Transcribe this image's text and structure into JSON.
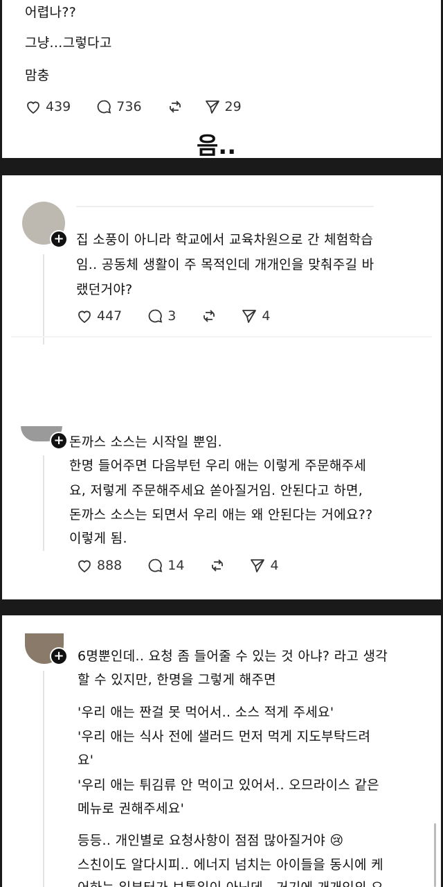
{
  "post1": {
    "lines": [
      "어렵나??",
      "그냥...그렇다고",
      "맘충"
    ],
    "likes": "439",
    "comments": "736",
    "shares": "29"
  },
  "caption": "음..",
  "post2": {
    "lines": [
      "집 소풍이 아니라 학교에서 교육차원으로 간 체험학습",
      "임.. 공동체 생활이 주 목적인데 개개인을 맞춰주길 바",
      "랬던거야?"
    ],
    "likes": "447",
    "comments": "3",
    "shares": "4"
  },
  "post3": {
    "lines": [
      "돈까스 소스는 시작일 뿐임.",
      "한명 들어주면 다음부턴 우리 애는 이렇게 주문해주세",
      "요, 저렇게 주문해주세요 쏟아질거임. 안된다고 하면,",
      "돈까스 소스는 되면서 우리 애는 왜 안된다는 거에요??",
      "이렇게 됨."
    ],
    "likes": "888",
    "comments": "14",
    "shares": "4"
  },
  "post4": {
    "lines": [
      "6명뿐인데.. 요청 좀 들어줄 수 있는 것 아냐? 라고 생각",
      "할 수 있지만, 한명을 그렇게 해주면",
      "'우리 애는 짠걸 못 먹어서.. 소스 적게 주세요'",
      "'우리 애는 식사 전에 샐러드 먼저 먹게 지도부탁드려",
      "요'",
      "'우리 애는 튀김류 안 먹이고 있어서.. 오므라이스 같은",
      "메뉴로 권해주세요'",
      "등등.. 개인별로 요청사항이 점점 많아질거야 😢",
      "스친이도 알다시피.. 에너지 넘치는 아이들을 동시에 케",
      "어하는 일부터가 보통일이 아닌데.. 거기에 개개인의 요"
    ]
  },
  "icons": [
    "heart-icon",
    "comment-icon",
    "repost-icon",
    "send-icon"
  ]
}
